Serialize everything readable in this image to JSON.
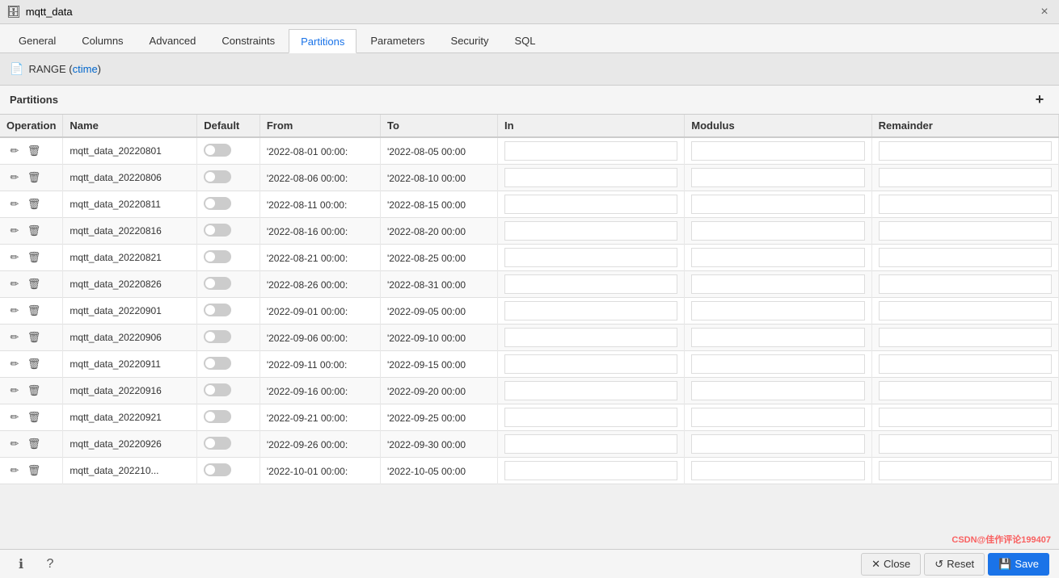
{
  "titleBar": {
    "icon": "🗄",
    "title": "mqtt_data",
    "closeLabel": "×"
  },
  "tabs": [
    {
      "id": "general",
      "label": "General",
      "active": false
    },
    {
      "id": "columns",
      "label": "Columns",
      "active": false
    },
    {
      "id": "advanced",
      "label": "Advanced",
      "active": false
    },
    {
      "id": "constraints",
      "label": "Constraints",
      "active": false
    },
    {
      "id": "partitions",
      "label": "Partitions",
      "active": true
    },
    {
      "id": "parameters",
      "label": "Parameters",
      "active": false
    },
    {
      "id": "security",
      "label": "Security",
      "active": false
    },
    {
      "id": "sql",
      "label": "SQL",
      "active": false
    }
  ],
  "rangeHeader": {
    "icon": "📄",
    "label": "RANGE (",
    "field": "ctime",
    "suffix": ")"
  },
  "partitionsSection": {
    "label": "Partitions",
    "addLabel": "+"
  },
  "tableColumns": [
    "Operation",
    "Name",
    "Default",
    "From",
    "To",
    "In",
    "Modulus",
    "Remainder"
  ],
  "rows": [
    {
      "name": "mqtt_data_20220801",
      "from": "'2022-08-01 00:00:",
      "to": "'2022-08-05 00:00"
    },
    {
      "name": "mqtt_data_20220806",
      "from": "'2022-08-06 00:00:",
      "to": "'2022-08-10 00:00"
    },
    {
      "name": "mqtt_data_20220811",
      "from": "'2022-08-11 00:00:",
      "to": "'2022-08-15 00:00"
    },
    {
      "name": "mqtt_data_20220816",
      "from": "'2022-08-16 00:00:",
      "to": "'2022-08-20 00:00"
    },
    {
      "name": "mqtt_data_20220821",
      "from": "'2022-08-21 00:00:",
      "to": "'2022-08-25 00:00"
    },
    {
      "name": "mqtt_data_20220826",
      "from": "'2022-08-26 00:00:",
      "to": "'2022-08-31 00:00"
    },
    {
      "name": "mqtt_data_20220901",
      "from": "'2022-09-01 00:00:",
      "to": "'2022-09-05 00:00"
    },
    {
      "name": "mqtt_data_20220906",
      "from": "'2022-09-06 00:00:",
      "to": "'2022-09-10 00:00"
    },
    {
      "name": "mqtt_data_20220911",
      "from": "'2022-09-11 00:00:",
      "to": "'2022-09-15 00:00"
    },
    {
      "name": "mqtt_data_20220916",
      "from": "'2022-09-16 00:00:",
      "to": "'2022-09-20 00:00"
    },
    {
      "name": "mqtt_data_20220921",
      "from": "'2022-09-21 00:00:",
      "to": "'2022-09-25 00:00"
    },
    {
      "name": "mqtt_data_20220926",
      "from": "'2022-09-26 00:00:",
      "to": "'2022-09-30 00:00"
    },
    {
      "name": "mqtt_data_202210...",
      "from": "'2022-10-01 00:00:",
      "to": "'2022-10-05 00:00"
    }
  ],
  "bottomBar": {
    "infoTooltip": "ℹ",
    "helpTooltip": "?",
    "closeLabel": "Close",
    "resetLabel": "Reset",
    "saveLabel": "Save"
  },
  "watermark": "CSDN@佳作评论199407"
}
